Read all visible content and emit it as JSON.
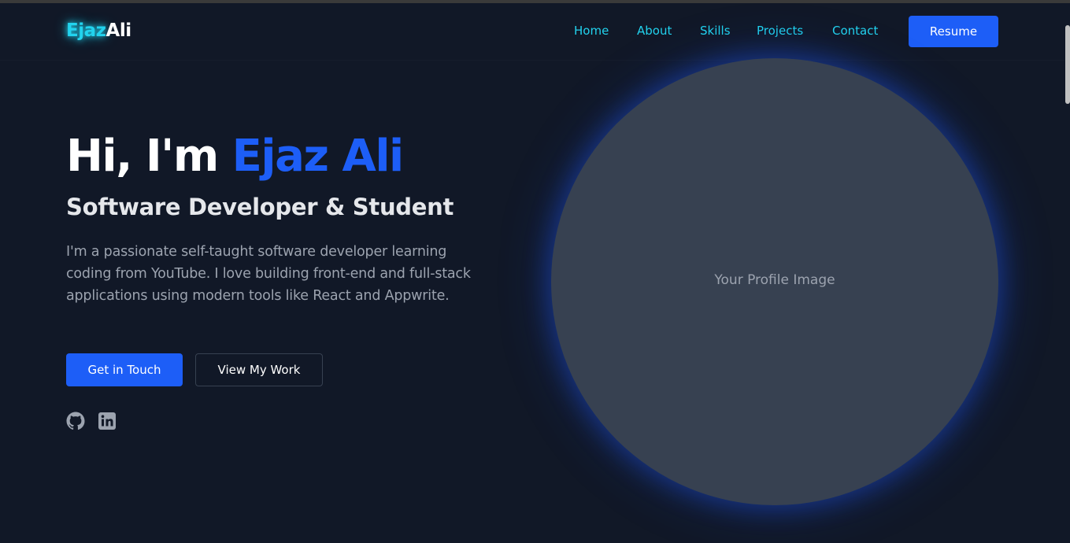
{
  "navbar": {
    "logo_first": "Ejaz",
    "logo_last": "Ali",
    "links": [
      "Home",
      "About",
      "Skills",
      "Projects",
      "Contact"
    ],
    "resume_label": "Resume"
  },
  "hero": {
    "greeting": "Hi, I'm ",
    "name": "Ejaz Ali",
    "subtitle": "Software Developer & Student",
    "bio": "I'm a passionate self-taught software developer learning coding from YouTube. I love building front-end and full-stack applications using modern tools like React and Appwrite.",
    "primary_button": "Get in Touch",
    "secondary_button": "View My Work",
    "social_icons": [
      "github-icon",
      "linkedin-icon"
    ]
  },
  "profile": {
    "placeholder": "Your Profile Image"
  },
  "colors": {
    "background": "#111827",
    "accent_cyan": "#22d3ee",
    "accent_blue": "#1d5ef7",
    "circle": "#374151",
    "muted_text": "#9ca3af"
  }
}
